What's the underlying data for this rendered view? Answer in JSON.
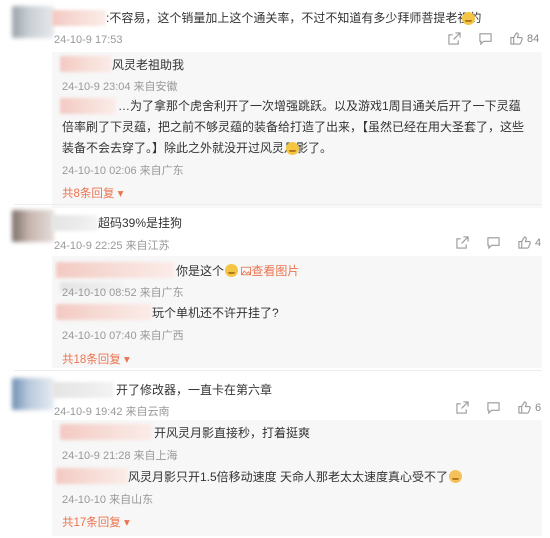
{
  "threads": [
    {
      "comment": {
        "text": ":不容易，这个销量加上这个通关率，不过不知道有多少拜师菩提老祖的",
        "date": "24-10-9 17:53",
        "likes": "84"
      },
      "replies": [
        {
          "text": "风灵老祖助我",
          "meta": "24-10-9 23:04 来自安徽"
        },
        {
          "text": "…为了拿那个虎舍利开了一次增强跳跃。以及游戏1周目通关后开了一下灵蕴倍率刷了下灵蕴，把之前不够灵蕴的装备给打造了出来，【虽然已经在用大圣套了，这些装备不会去穿了。】除此之外就没开过风灵月影了。",
          "meta": "24-10-10 02:06 来自广东"
        }
      ],
      "more": "共8条回复"
    },
    {
      "comment": {
        "text": "超码39%是挂狗",
        "date": "24-10-9 22:25 来自江苏",
        "likes": "4"
      },
      "replies": [
        {
          "text": "你是这个",
          "link": "查看图片",
          "meta": "24-10-10 08:52 来自广东"
        },
        {
          "text": "玩个单机还不许开挂了?",
          "meta": "24-10-10 07:40 来自广西"
        }
      ],
      "more": "共18条回复"
    },
    {
      "comment": {
        "text": "开了修改器，一直卡在第六章",
        "date": "24-10-9 19:42 来自云南",
        "likes": "6"
      },
      "replies": [
        {
          "text": "开风灵月影直接秒，打着挺爽",
          "meta": "24-10-9 21:28 来自上海"
        },
        {
          "text": "风灵月影只开1.5倍移动速度 天命人那老太太速度真心受不了",
          "meta": "24-10-10 来自山东"
        }
      ],
      "more": "共17条回复"
    }
  ],
  "icons": [
    "share-icon",
    "comment-icon",
    "like-icon",
    "emoji-icon",
    "image-icon",
    "caret-down-icon"
  ],
  "colors": {
    "accent": "#eb7350",
    "meta": "#999999",
    "reply_bg": "#f7f7f7"
  }
}
